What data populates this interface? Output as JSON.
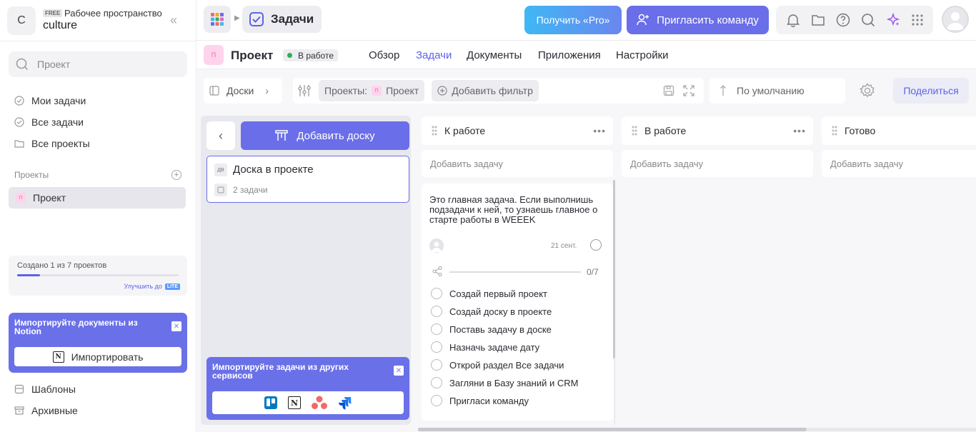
{
  "workspace": {
    "initial": "C",
    "plan": "FREE",
    "label": "Рабочее пространство",
    "name": "culture"
  },
  "sidebar": {
    "search_placeholder": "Проект",
    "nav": [
      {
        "label": "Мои задачи"
      },
      {
        "label": "Все задачи"
      },
      {
        "label": "Все проекты"
      }
    ],
    "projects_header": "Проекты",
    "project": {
      "badge": "П",
      "label": "Проект"
    },
    "limit": {
      "text": "Создано 1 из 7 проектов",
      "used": 1,
      "total": 7,
      "upgrade": "Улучшить до",
      "tier": "LITE"
    },
    "promo": {
      "text": "Импортируйте документы из Notion",
      "button": "Импортировать"
    },
    "bottom": [
      {
        "label": "Шаблоны"
      },
      {
        "label": "Архивные"
      }
    ]
  },
  "header": {
    "breadcrumb": "Задачи",
    "pro_button": "Получить «Pro»",
    "invite_button": "Пригласить команду",
    "icons": [
      "bell-icon",
      "folder-icon",
      "help-icon",
      "search-icon",
      "sparkle-icon",
      "apps-icon"
    ]
  },
  "project": {
    "badge": "П",
    "name": "Проект",
    "status": "В работе",
    "status_color": "#2fae5b",
    "tabs": [
      "Обзор",
      "Задачи",
      "Документы",
      "Приложения",
      "Настройки"
    ],
    "active_tab": "Задачи"
  },
  "toolbar": {
    "boards_label": "Доски",
    "filter_label": "Проекты:",
    "filter_badge": "П",
    "filter_value": "Проект",
    "add_filter": "Добавить фильтр",
    "sort_label": "По умолчанию",
    "share_button": "Поделиться"
  },
  "boards_panel": {
    "add_board": "Добавить доску",
    "board": {
      "badge": "ДВ",
      "title": "Доска в проекте",
      "count": "2 задачи"
    },
    "import": {
      "text": "Импортируйте задачи из других сервисов",
      "services": [
        "trello-icon",
        "notion-icon",
        "asana-icon",
        "jira-icon"
      ]
    }
  },
  "columns": [
    {
      "title": "К работе",
      "add_task": "Добавить задачу"
    },
    {
      "title": "В работе",
      "add_task": "Добавить задачу"
    },
    {
      "title": "Готово",
      "add_task": "Добавить задачу"
    }
  ],
  "task": {
    "title": "Это главная задача. Если выполнишь подзадачи к ней, то узнаешь главное о старте работы в WEEEK",
    "date": "21 сент.",
    "progress": "0/7",
    "subtasks": [
      "Создай первый проект",
      "Создай доску в проекте",
      "Поставь задачу в доске",
      "Назначь задаче дату",
      "Открой раздел Все задачи",
      "Загляни в Базу знаний и CRM",
      "Пригласи команду"
    ]
  },
  "colors": {
    "accent": "#5b63e8",
    "button": "#6a6ee8",
    "pro_gradient_start": "#3fb8f4",
    "pro_gradient_end": "#6a86f0"
  }
}
